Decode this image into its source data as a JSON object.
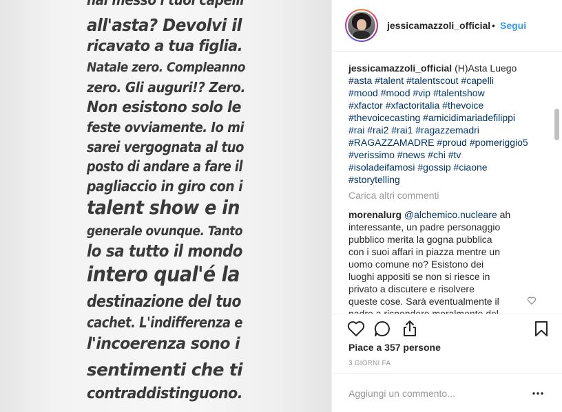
{
  "post": {
    "image_text_lines": [
      "hai messo i tuoi capelli",
      "all'asta? Devolvi il",
      "ricavato a tua figlia.",
      "Natale zero. Compleanno",
      "zero. Gli auguri!? Zero.",
      "Non esistono solo le",
      "feste ovviamente. Io mi",
      "sarei vergognata al tuo",
      "posto di andare a fare il",
      "pagliaccio in giro con i",
      "talent show e  in",
      "generale ovunque. Tanto",
      "lo sa tutto il mondo",
      "intero qual'é la",
      "destinazione del tuo",
      "cachet. L'indifferenza e",
      "l'incoerenza sono i",
      "sentimenti che ti",
      "contraddistinguono."
    ]
  },
  "header": {
    "username": "jessicamazzoli_official",
    "separator": "•",
    "follow_label": "Segui"
  },
  "caption": {
    "username": "jessicamazzoli_official",
    "text": " (H)Asta Luego",
    "hashtags": [
      "#asta #talent #talentscout #capelli",
      "#mood #mood #vip #talentshow",
      "#xfactor #xfactoritalia #thevoice",
      "#thevoicecasting #amicidimariadefilippi",
      "#rai #rai2 #rai1 #ragazzemadri",
      "#RAGAZZAMADRE #proud #pomeriggio5",
      "#verissimo #news #chi #tv",
      "#isoladeifamosi #gossip #ciaone",
      "#storytelling"
    ]
  },
  "load_more_label": "Carica altri commenti",
  "comment": {
    "username": "morenalurg",
    "mention": "@alchemico.nucleare",
    "lines": [
      " ah",
      "interessante, un padre personaggio",
      "pubblico merita la gogna pubblica",
      "con i suoi affari in piazza mentre un",
      "uomo comune no? Esistono dei",
      "luoghi appositi se non si riesce in",
      "privato a discutere e risolvere",
      "queste cose. Sarà eventualmente il",
      "padre a rispondere moralmente del"
    ]
  },
  "icons": {
    "like": "heart-outline-icon",
    "comment": "speech-bubble-icon",
    "share": "share-icon",
    "save": "bookmark-icon",
    "comment_like": "small-heart-icon",
    "more": "ellipsis-icon"
  },
  "likes_text": "Piace a 357 persone",
  "date_text": "3 GIORNI FA",
  "add_comment": {
    "placeholder": "Aggiungi un commento..."
  },
  "colors": {
    "link": "#003569",
    "follow": "#3897f0",
    "muted": "#999999",
    "text": "#262626"
  }
}
